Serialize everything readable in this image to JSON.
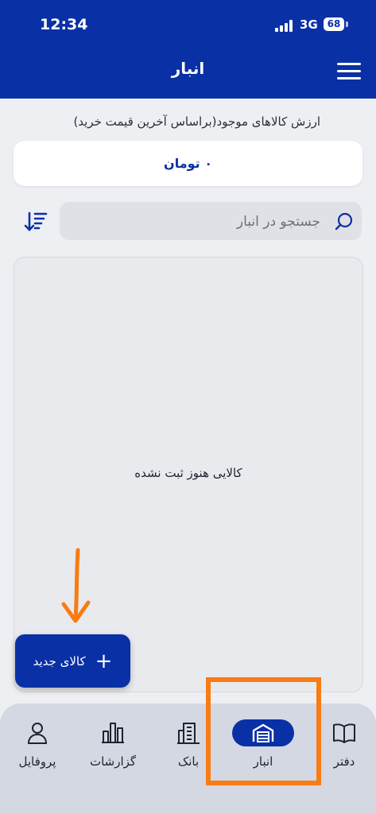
{
  "status": {
    "time": "12:34",
    "network": "3G",
    "battery": "68"
  },
  "header": {
    "title": "انبار"
  },
  "inventory": {
    "label": "ارزش کالاهای موجود(براساس آخرین قیمت خرید)",
    "value": "۰ تومان"
  },
  "search": {
    "placeholder": "جستجو در انبار"
  },
  "list": {
    "empty_message": "کالایی هنوز ثبت نشده"
  },
  "fab": {
    "label": "کالای جدید",
    "icon": "plus-icon"
  },
  "bottom_nav": {
    "items": [
      {
        "label": "دفتر",
        "icon": "book-icon"
      },
      {
        "label": "انبار",
        "icon": "warehouse-icon"
      },
      {
        "label": "بانک",
        "icon": "bank-building-icon"
      },
      {
        "label": "گزارشات",
        "icon": "bar-chart-icon"
      },
      {
        "label": "پروفایل",
        "icon": "user-icon"
      }
    ],
    "active": "انبار"
  },
  "colors": {
    "primary": "#0a30a6",
    "highlight": "#f87c14",
    "background": "#eeeff3"
  }
}
